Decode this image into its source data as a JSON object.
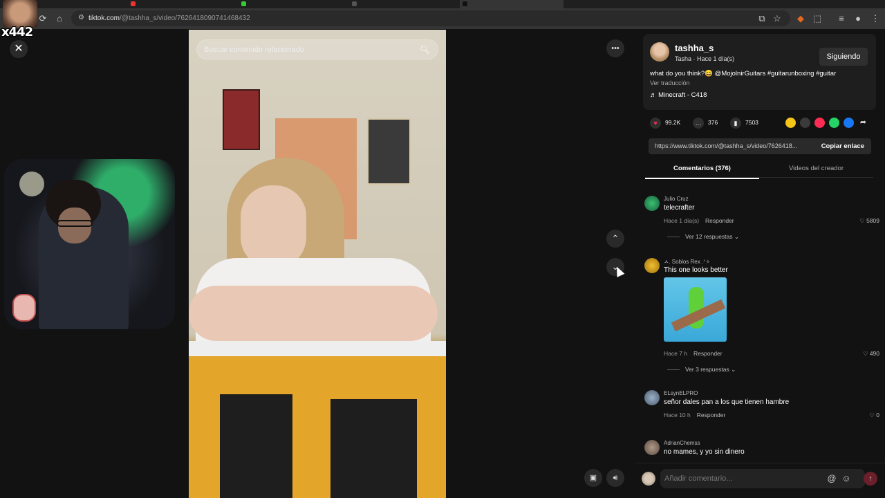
{
  "browser": {
    "tabs": [
      "",
      "",
      "",
      "",
      ""
    ],
    "url_domain": "tiktok.com",
    "url_path": "/@tashha_s/video/7626418090741468432",
    "icons": [
      "reload-icon",
      "home-icon",
      "site-info-icon",
      "install-icon",
      "star-icon",
      "extensions-icon",
      "profile-icon",
      "menu-icon"
    ]
  },
  "overlay": {
    "streamer_tag": "x442",
    "close_glyph": "✕"
  },
  "video": {
    "search_placeholder": "Buscar contenido relacionado"
  },
  "panel": {
    "username": "tashha_s",
    "subtitle": "Tasha · Hace 1 día(s)",
    "follow_label": "Siguiendo",
    "description": "what do you think?😄 @MojolnirGuitars #guitarunboxing #guitar",
    "translate_label": "Ver traducción",
    "music": "♬  Minecraft - C418",
    "stats": {
      "likes": "99.2K",
      "comments": "376",
      "saves": "7503"
    },
    "link": "https://www.tiktok.com/@tashha_s/video/7626418...",
    "copy_label": "Copiar enlace",
    "tab_comments": "Comentarios (376)",
    "tab_videos": "Videos del creador",
    "colors": {
      "like": "#fe2c55",
      "accent_share": [
        "#f5c518",
        "#3a3a3a",
        "#fe2c55",
        "#25d366",
        "#1877f2"
      ]
    }
  },
  "comments": [
    {
      "name": "Julio Cruz",
      "text": "telecrafter",
      "time": "Hace 1 día(s)",
      "reply": "Responder",
      "likes": "5809",
      "more": "Ver 12 respuestas ⌄"
    },
    {
      "name": "ㅅ. Soblos Rex .ᐟ✧",
      "text": "This one looks better",
      "time": "Hace 7 h",
      "reply": "Responder",
      "likes": "490",
      "more": "Ver 3 respuestas ⌄"
    },
    {
      "name": "ELsynELPRO",
      "text": "señor dales pan a los que tienen hambre",
      "time": "Hace 10 h",
      "reply": "Responder",
      "likes": "0"
    },
    {
      "name": "AdrianChemss",
      "text": "no mames, y yo sin dinero"
    }
  ],
  "comment_bar": {
    "placeholder": "Añadir comentario..."
  }
}
